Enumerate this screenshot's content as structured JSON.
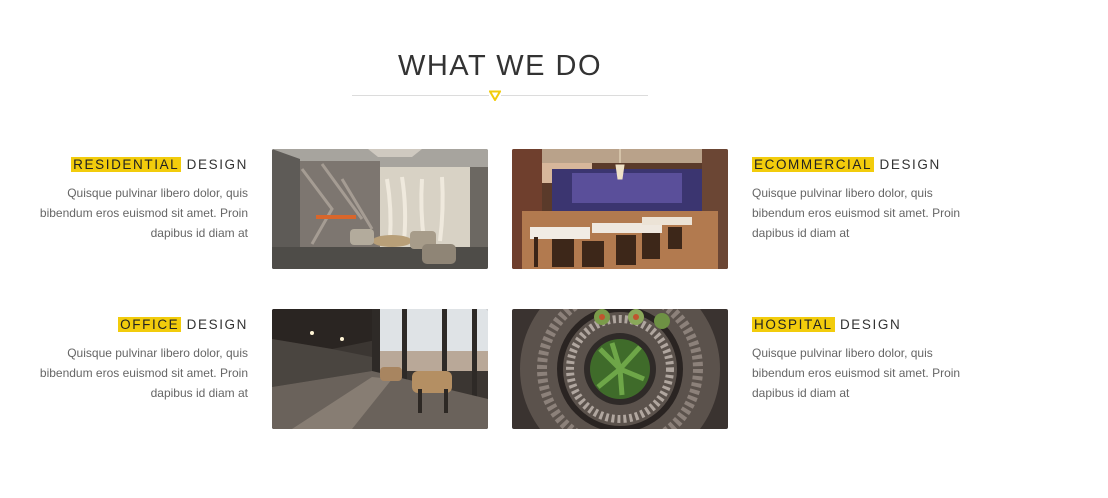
{
  "section": {
    "title": "WHAT WE DO",
    "accent_color": "#f2cc0c",
    "divider_icon": "triangle-down-icon"
  },
  "services": [
    {
      "highlight": "RESIDENTIAL",
      "suffix": "DESIGN",
      "description": "Quisque pulvinar libero dolor, quis bibendum eros euismod sit amet. Proin dapibus id diam at",
      "image": "residential-interior-photo"
    },
    {
      "highlight": "ECOMMERCIAL",
      "suffix": "DESIGN",
      "description": "Quisque pulvinar libero dolor, quis bibendum eros euismod sit amet. Proin dapibus id diam at",
      "image": "restaurant-interior-photo"
    },
    {
      "highlight": "OFFICE",
      "suffix": "DESIGN",
      "description": "Quisque pulvinar libero dolor, quis bibendum eros euismod sit amet. Proin dapibus id diam at",
      "image": "office-corridor-photo"
    },
    {
      "highlight": "HOSPITAL",
      "suffix": "DESIGN",
      "description": "Quisque pulvinar libero dolor, quis bibendum eros euismod sit amet. Proin dapibus id diam at",
      "image": "spiral-staircase-photo"
    }
  ]
}
